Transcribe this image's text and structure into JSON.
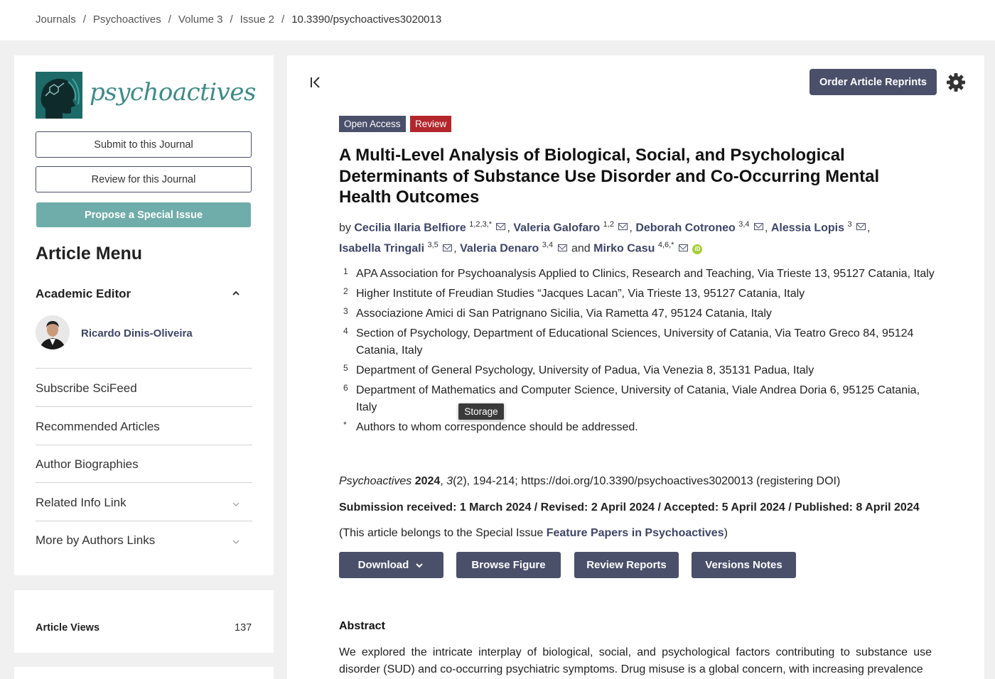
{
  "breadcrumb": {
    "items": [
      "Journals",
      "Psychoactives",
      "Volume 3",
      "Issue 2"
    ],
    "current": "10.3390/psychoactives3020013"
  },
  "sidebar": {
    "logo_text": "psychoactives",
    "submit_label": "Submit to this Journal",
    "review_label": "Review for this Journal",
    "propose_label": "Propose a Special Issue",
    "menu_title": "Article Menu",
    "academic_editor_label": "Academic Editor",
    "editor_name": "Ricardo Dinis-Oliveira",
    "links": [
      "Subscribe SciFeed",
      "Recommended Articles",
      "Author Biographies",
      "Related Info Link",
      "More by Authors Links"
    ],
    "views_label": "Article Views",
    "views_count": "137"
  },
  "main": {
    "reprints_label": "Order Article Reprints",
    "badge_open_access": "Open Access",
    "badge_review": "Review",
    "title": "A Multi-Level Analysis of Biological, Social, and Psychological Determinants of Substance Use Disorder and Co-Occurring Mental Health Outcomes",
    "by_label": "by",
    "and_label": "and",
    "authors": [
      {
        "name": "Cecilia Ilaria Belfiore",
        "sup": "1,2,3,*"
      },
      {
        "name": "Valeria Galofaro",
        "sup": "1,2"
      },
      {
        "name": "Deborah Cotroneo",
        "sup": "3,4"
      },
      {
        "name": "Alessia Lopis",
        "sup": "3"
      },
      {
        "name": "Isabella Tringali",
        "sup": "3,5"
      },
      {
        "name": "Valeria Denaro",
        "sup": "3,4"
      },
      {
        "name": "Mirko Casu",
        "sup": "4,6,*"
      }
    ],
    "orcid_label": "iD",
    "affiliations": [
      {
        "num": "1",
        "text": "APA Association for Psychoanalysis Applied to Clinics, Research and Teaching, Via Trieste 13, 95127 Catania, Italy"
      },
      {
        "num": "2",
        "text": "Higher Institute of Freudian Studies “Jacques Lacan”, Via Trieste 13, 95127 Catania, Italy"
      },
      {
        "num": "3",
        "text": "Associazione Amici di San Patrignano Sicilia, Via Rametta 47, 95124 Catania, Italy"
      },
      {
        "num": "4",
        "text": "Section of Psychology, Department of Educational Sciences, University of Catania, Via Teatro Greco 84, 95124 Catania, Italy"
      },
      {
        "num": "5",
        "text": "Department of General Psychology, University of Padua, Via Venezia 8, 35131 Padua, Italy"
      },
      {
        "num": "6",
        "text": "Department of Mathematics and Computer Science, University of Catania, Viale Andrea Doria 6, 95125 Catania, Italy"
      },
      {
        "num": "*",
        "text": "Authors to whom correspondence should be addressed."
      }
    ],
    "tooltip": "Storage",
    "citation": {
      "journal": "Psychoactives",
      "year": "2024",
      "volume": "3",
      "rest": "(2), 194-214; https://doi.org/10.3390/psychoactives3020013 (registering DOI)"
    },
    "dates": "Submission received: 1 March 2024 / Revised: 2 April 2024 / Accepted: 5 April 2024 / Published: 8 April 2024",
    "special_prefix": "(This article belongs to the Special Issue ",
    "special_link": "Feature Papers in Psychoactives",
    "special_suffix": ")",
    "buttons": {
      "download": "Download",
      "browse_figure": "Browse Figure",
      "review_reports": "Review Reports",
      "versions_notes": "Versions Notes"
    },
    "abstract_heading": "Abstract",
    "abstract_text": "We explored the intricate interplay of biological, social, and psychological factors contributing to substance use disorder (SUD) and co-occurring psychiatric symptoms. Drug misuse is a global concern, with increasing prevalence"
  }
}
